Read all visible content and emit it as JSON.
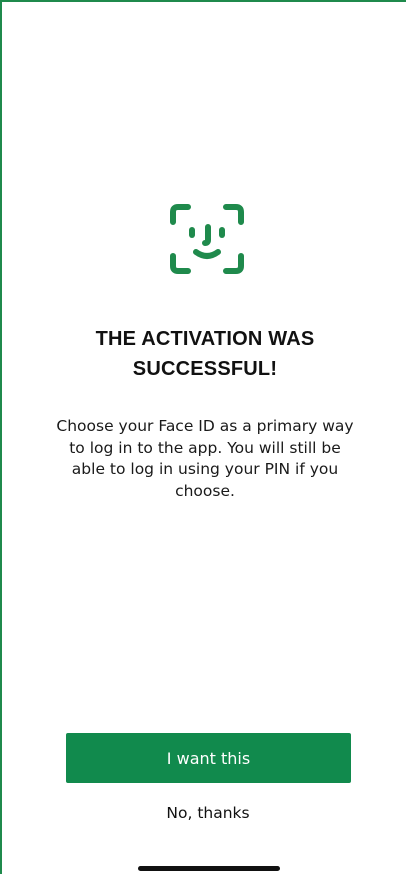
{
  "icon": {
    "name": "face-id-icon",
    "color": "#1f8a4c"
  },
  "title": "THE ACTIVATION WAS SUCCESSFUL!",
  "description": "Choose your Face ID as a primary way to log in to the app. You will still be able to log in using your PIN if you choose.",
  "actions": {
    "primary_label": "I want this",
    "secondary_label": "No, thanks"
  },
  "colors": {
    "accent": "#118a4d",
    "text": "#111111",
    "background": "#ffffff"
  }
}
